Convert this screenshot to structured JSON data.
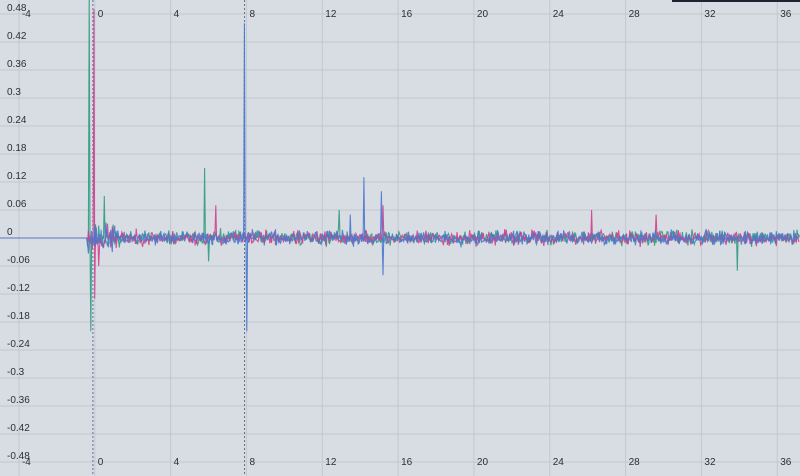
{
  "chart_data": {
    "type": "line",
    "title": "",
    "xlabel": "",
    "ylabel": "",
    "xlim": [
      -5,
      37.2
    ],
    "ylim": [
      -0.51,
      0.51
    ],
    "grid": true,
    "x_ticks": [
      -4,
      0,
      4,
      8,
      12,
      16,
      20,
      24,
      28,
      32,
      36
    ],
    "x_tick_labels": [
      "-4",
      "0",
      "4",
      "8",
      "12",
      "16",
      "20",
      "24",
      "28",
      "32",
      "36"
    ],
    "y_ticks": [
      0.48,
      0.42,
      0.36,
      0.3,
      0.24,
      0.18,
      0.12,
      0.06,
      0,
      -0.06,
      -0.12,
      -0.18,
      -0.24,
      -0.3,
      -0.36,
      -0.42,
      -0.48
    ],
    "y_tick_labels": [
      "0.48",
      "0.42",
      "0.36",
      "0.3",
      "0.24",
      "0.18",
      "0.12",
      "0.06",
      "0",
      "-0.06",
      "-0.12",
      "-0.18",
      "-0.24",
      "-0.3",
      "-0.36",
      "-0.42",
      "-0.48"
    ],
    "markers": [
      -0.1,
      7.9
    ],
    "series": [
      {
        "color": "#2f9a7c",
        "noise": 0.022,
        "seed": 11,
        "peaks": [
          [
            -0.3,
            0.52
          ],
          [
            -0.2,
            -0.2
          ],
          [
            0.5,
            0.09
          ],
          [
            5.8,
            0.15
          ],
          [
            6.0,
            -0.05
          ],
          [
            12.9,
            0.06
          ],
          [
            33.9,
            -0.07
          ]
        ]
      },
      {
        "color": "#d23e8e",
        "noise": 0.022,
        "seed": 23,
        "peaks": [
          [
            -0.05,
            0.49
          ],
          [
            0.0,
            -0.13
          ],
          [
            0.2,
            -0.06
          ],
          [
            6.4,
            0.07
          ],
          [
            15.2,
            0.07
          ],
          [
            26.2,
            0.06
          ],
          [
            29.6,
            0.05
          ]
        ]
      },
      {
        "color": "#4a78cc",
        "noise": 0.022,
        "seed": 37,
        "peaks": [
          [
            7.9,
            0.46
          ],
          [
            8.0,
            -0.2
          ],
          [
            14.2,
            0.13
          ],
          [
            15.1,
            0.1
          ],
          [
            15.2,
            -0.08
          ],
          [
            13.5,
            0.05
          ]
        ]
      }
    ]
  }
}
